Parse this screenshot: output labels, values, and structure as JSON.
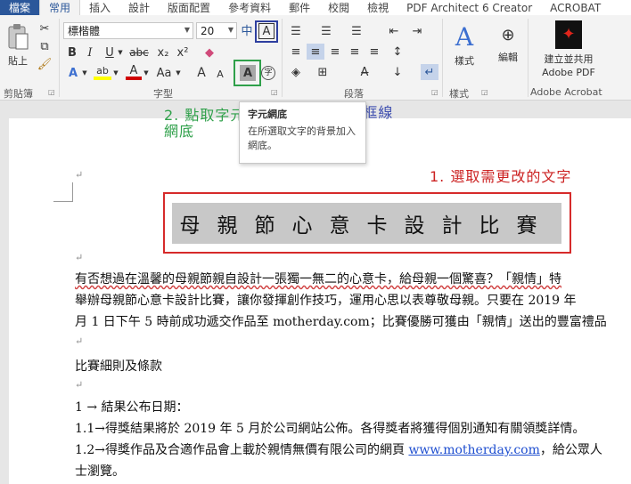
{
  "tabs": {
    "file": "檔案",
    "items": [
      "常用",
      "插入",
      "設計",
      "版面配置",
      "參考資料",
      "郵件",
      "校閱",
      "檢視",
      "PDF Architect 6 Creator",
      "ACROBAT"
    ],
    "active": "常用"
  },
  "ribbon": {
    "clipboard": {
      "paste_label": "貼上",
      "group_label": "剪貼簿"
    },
    "font": {
      "font_name": "標楷體",
      "font_size": "20",
      "phonetic_label": "中",
      "char_border_label": "A",
      "group_label": "字型",
      "bold": "B",
      "italic": "I",
      "underline": "U",
      "strike": "abc",
      "subscript": "x₂",
      "superscript": "x²",
      "text_effects": "A",
      "highlight": "ab",
      "font_color": "A",
      "case": "Aa",
      "grow": "A",
      "shrink": "A",
      "char_shading": "A",
      "enclose": "字"
    },
    "paragraph": {
      "group_label": "段落"
    },
    "styles": {
      "button_label": "樣式",
      "group_label": "樣式"
    },
    "editing": {
      "button_label": "編輯"
    },
    "adobe": {
      "button_label_line1": "建立並共用",
      "button_label_line2": "Adobe PDF",
      "group_label": "Adobe Acrobat"
    }
  },
  "tooltip": {
    "title": "字元網底",
    "body": "在所選取文字的背景加入網底。"
  },
  "annotations": {
    "step1": "1. 選取需更改的文字",
    "step2_line1": "2. 點取字元",
    "step2_line2": "網底",
    "step3": "3. 點選字元框線"
  },
  "document": {
    "title": "母親節心意卡設計比賽",
    "para1_line1": "有否想過在溫馨的母親節親自設計一張獨一無二的心意卡，給母親一個驚喜？「親情」特",
    "para1_line2": "舉辦母親節心意卡設計比賽，讓你發揮創作技巧，運用心思以表尊敬母親。只要在 2019 年",
    "para1_line3": "月 1 日下午 5 時前成功遞交作品至 motherday.com；比賽優勝可獲由「親情」送出的豐富禮品",
    "heading": "比賽細則及條款",
    "item1": "1 → 結果公布日期：",
    "item1_1": "1.1→得獎結果將於 2019 年 5 月於公司網站公佈。各得獎者將獲得個別通知有關領獎詳情。",
    "item1_2_pre": "1.2→得獎作品及合適作品會上載於親情無價有限公司的網頁 ",
    "item1_2_link": "www.motherday.com",
    "item1_2_post": "，給公眾人",
    "item1_2_cont": "士瀏覽。",
    "para_mark": "↵"
  },
  "colors": {
    "file_tab": "#2b579a",
    "annotation_red": "#cc2222",
    "annotation_green": "#2fa04a",
    "annotation_blue": "#3f4fb0",
    "link": "#1f4fd0"
  }
}
